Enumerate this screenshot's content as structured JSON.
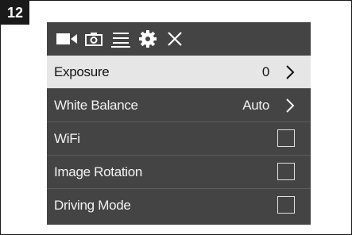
{
  "step": {
    "number": "12"
  },
  "toolbar": {
    "icons": [
      "video-camera-icon",
      "photo-camera-icon",
      "menu-icon",
      "gear-icon",
      "close-icon"
    ],
    "active": "menu-icon"
  },
  "menu": {
    "items": [
      {
        "label": "Exposure",
        "value": "0",
        "control": "chevron",
        "selected": true
      },
      {
        "label": "White Balance",
        "value": "Auto",
        "control": "chevron",
        "selected": false
      },
      {
        "label": "WiFi",
        "value": "",
        "control": "checkbox",
        "checked": false
      },
      {
        "label": "Image Rotation",
        "value": "",
        "control": "checkbox",
        "checked": false
      },
      {
        "label": "Driving Mode",
        "value": "",
        "control": "checkbox",
        "checked": false
      }
    ]
  },
  "colors": {
    "screen_background": "#444444",
    "selected_row": "#e6e6e6",
    "badge": "#1a1a1a"
  }
}
